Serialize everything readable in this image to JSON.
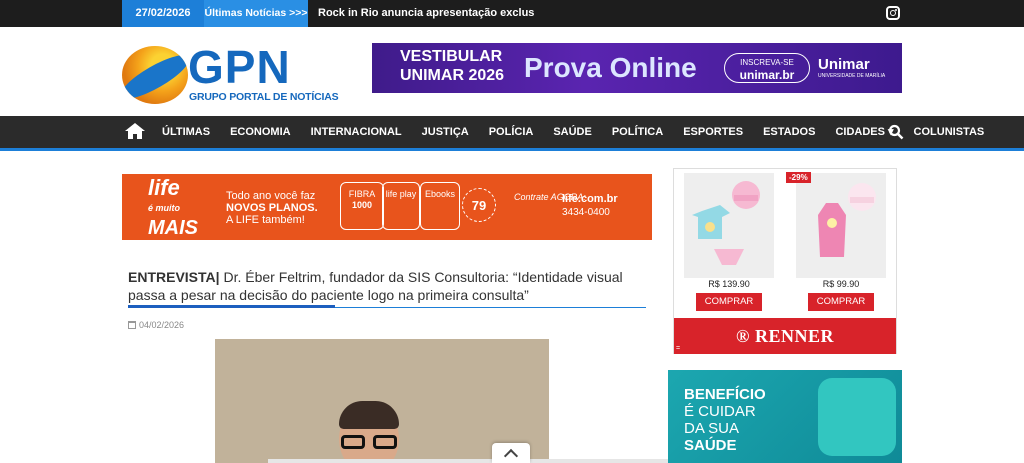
{
  "topbar": {
    "date": "27/02/2026",
    "latest_label": "Últimas Notícias >>>",
    "ticker": "Rock in Rio anuncia apresentação exclusiva do F"
  },
  "logo": {
    "name": "GPN",
    "subtitle": "GRUPO PORTAL DE NOTÍCIAS"
  },
  "top_banner": {
    "line1": "VESTIBULAR",
    "line2": "UNIMAR 2026",
    "headline": "Prova Online",
    "cta_small": "INSCREVA-SE",
    "cta_url": "unimar.br",
    "brand": "Unimar",
    "brand_sub": "UNIVERSIDADE DE MARÍLIA"
  },
  "nav": {
    "items": [
      "ÚLTIMAS",
      "ECONOMIA",
      "INTERNACIONAL",
      "JUSTIÇA",
      "POLÍCIA",
      "SAÚDE",
      "POLÍTICA",
      "ESPORTES",
      "ESTADOS",
      "CIDADES ▾",
      "COLUNISTAS"
    ]
  },
  "life_ad": {
    "brand_top": "life",
    "brand_mid": "é muito",
    "brand_bottom": "MAIS",
    "tag1": "Todo ano você faz",
    "tag2": "NOVOS PLANOS.",
    "tag3": "A LIFE também!",
    "box1_title": "FIBRA",
    "box1_value": "1000",
    "box2_title": "life play",
    "box3_title": "Ebooks",
    "price": "79",
    "cta": "Contrate AGORA:",
    "site": "life.com.br",
    "phone": "3434-0400"
  },
  "article": {
    "lead": "ENTREVISTA|",
    "title": " Dr. Éber Feltrim, fundador da SIS Consultoria: “Identidade visual passa a pesar na decisão do paciente logo na primeira consulta”",
    "date": "04/02/2026"
  },
  "renner_ad": {
    "badge": "-29%",
    "price1": "R$ 139.90",
    "price2": "R$ 99.90",
    "buy_label": "COMPRAR",
    "brand": "RENNER",
    "tiny": "="
  },
  "benefit_ad": {
    "line1": "BENEFÍCIO",
    "line2": "É CUIDAR",
    "line3": "DA SUA",
    "line4": "SAÚDE"
  },
  "colors": {
    "accent": "#1d7fd8",
    "nav_bg": "#2b2b2b",
    "renner_red": "#d8232a"
  }
}
